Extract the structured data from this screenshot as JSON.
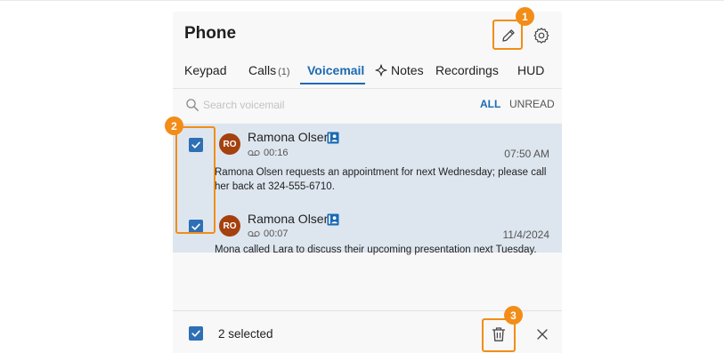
{
  "header": {
    "title": "Phone"
  },
  "tabs": [
    {
      "label": "Keypad"
    },
    {
      "label": "Calls",
      "count": "(1)"
    },
    {
      "label": "Voicemail",
      "active": true
    },
    {
      "label": "Notes"
    },
    {
      "label": "Recordings"
    },
    {
      "label": "HUD"
    }
  ],
  "search": {
    "placeholder": "Search voicemail",
    "value": ""
  },
  "filters": {
    "all": "ALL",
    "unread": "UNREAD",
    "selected": "ALL"
  },
  "voicemails": [
    {
      "initials": "RO",
      "name": "Ramona Olsen",
      "duration": "00:16",
      "time": "07:50 AM",
      "transcript": "Ramona Olsen requests an appointment for next Wednesday; please call her back at 324-555-6710.",
      "checked": true
    },
    {
      "initials": "RO",
      "name": "Ramona Olsen",
      "duration": "00:07",
      "time": "11/4/2024",
      "transcript": "Mona called Lara to discuss their upcoming presentation next Tuesday.",
      "checked": true
    }
  ],
  "footer": {
    "selected_label": "2 selected"
  },
  "callouts": [
    "1",
    "2",
    "3"
  ],
  "icons": {
    "edit": "pencil-icon",
    "settings": "gear-icon",
    "notes": "sparkle-icon",
    "search": "search-icon",
    "contact": "contact-card-icon",
    "voicemail": "voicemail-icon",
    "delete": "trash-icon",
    "close": "close-icon",
    "check": "check-icon"
  },
  "colors": {
    "accent": "#1b6ab3",
    "checkbox": "#2e6fb6",
    "avatar": "#a4410f",
    "highlight": "#f28d17",
    "selected_row_bg": "#dde6ef"
  }
}
